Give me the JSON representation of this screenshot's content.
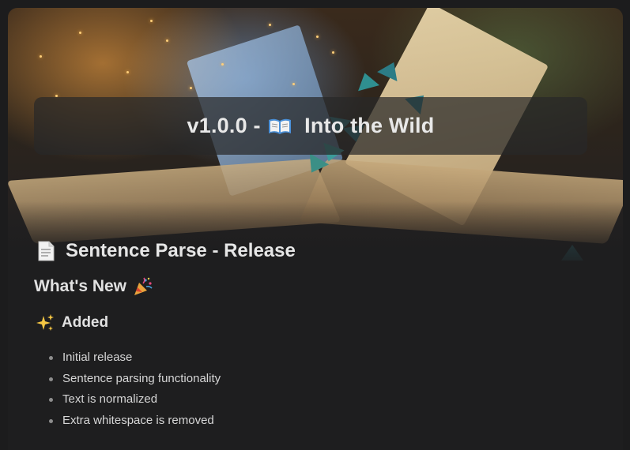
{
  "release": {
    "banner_title_prefix": "v1.0.0 -",
    "banner_title_suffix": "Into the Wild",
    "banner_icon": "open-book-icon"
  },
  "document": {
    "icon": "page-document-icon",
    "title": "Sentence Parse - Release"
  },
  "whats_new": {
    "heading": "What's New",
    "icon": "party-popper-icon"
  },
  "added": {
    "icon": "sparkles-icon",
    "heading": "Added",
    "items": [
      "Initial release",
      "Sentence parsing functionality",
      "Text is normalized",
      "Extra whitespace is removed"
    ]
  },
  "colors": {
    "background": "#1c1c1d",
    "card": "#1e1e1f",
    "text": "#e6e6e6",
    "bird_teal": "#2c7c86"
  }
}
